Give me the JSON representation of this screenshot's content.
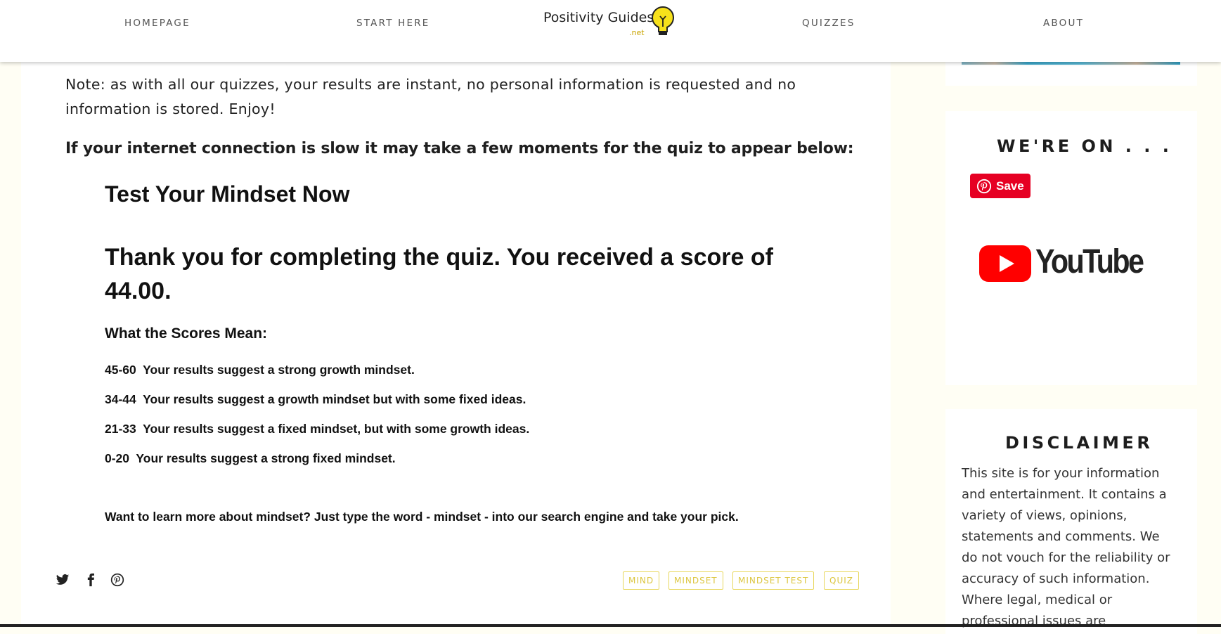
{
  "nav": {
    "homepage": "HOMEPAGE",
    "start_here": "START HERE",
    "quizzes": "QUIZZES",
    "about": "ABOUT",
    "logo_text": "Positivity Guides",
    "logo_sub": ".net"
  },
  "article": {
    "note": "Note: as with all our quizzes, your results are instant, no personal information is requested and no information is stored. Enjoy!",
    "slow_note": "If your internet connection is slow it may take a few moments for the quiz to appear below:",
    "quiz_title": "Test Your Mindset Now",
    "result": "Thank you for completing the quiz. You received a score of 44.00.",
    "scores_heading": "What the Scores Mean:",
    "scores": [
      "45-60  Your results suggest a strong growth mindset.",
      "34-44  Your results suggest a growth mindset but with some fixed ideas.",
      "21-33  Your results suggest a fixed mindset, but with some growth ideas.",
      "0-20  Your results suggest a strong fixed mindset."
    ],
    "learn_more": "Want to learn more about mindset? Just type the word - mindset - into our search engine and take your pick.",
    "tags": [
      "MIND",
      "MINDSET",
      "MINDSET TEST",
      "QUIZ"
    ]
  },
  "sidebar": {
    "were_on_title": "WE'RE ON . . .",
    "pin_save_label": "Save",
    "youtube_label": "YouTube",
    "disclaimer_title": "DISCLAIMER",
    "disclaimer_text": "This site is for your information and entertainment. It contains a variety of views, opinions, statements and comments. We do not vouch for the reliability or accuracy of such information. Where legal, medical or professional issues are"
  },
  "colors": {
    "page_bg": "#fffef4",
    "tag_border": "#e8d75c",
    "pinterest_red": "#e60023",
    "youtube_red": "#ff0000"
  },
  "icons": [
    "lightbulb-icon",
    "twitter-icon",
    "facebook-icon",
    "pinterest-icon",
    "youtube-play-icon"
  ]
}
